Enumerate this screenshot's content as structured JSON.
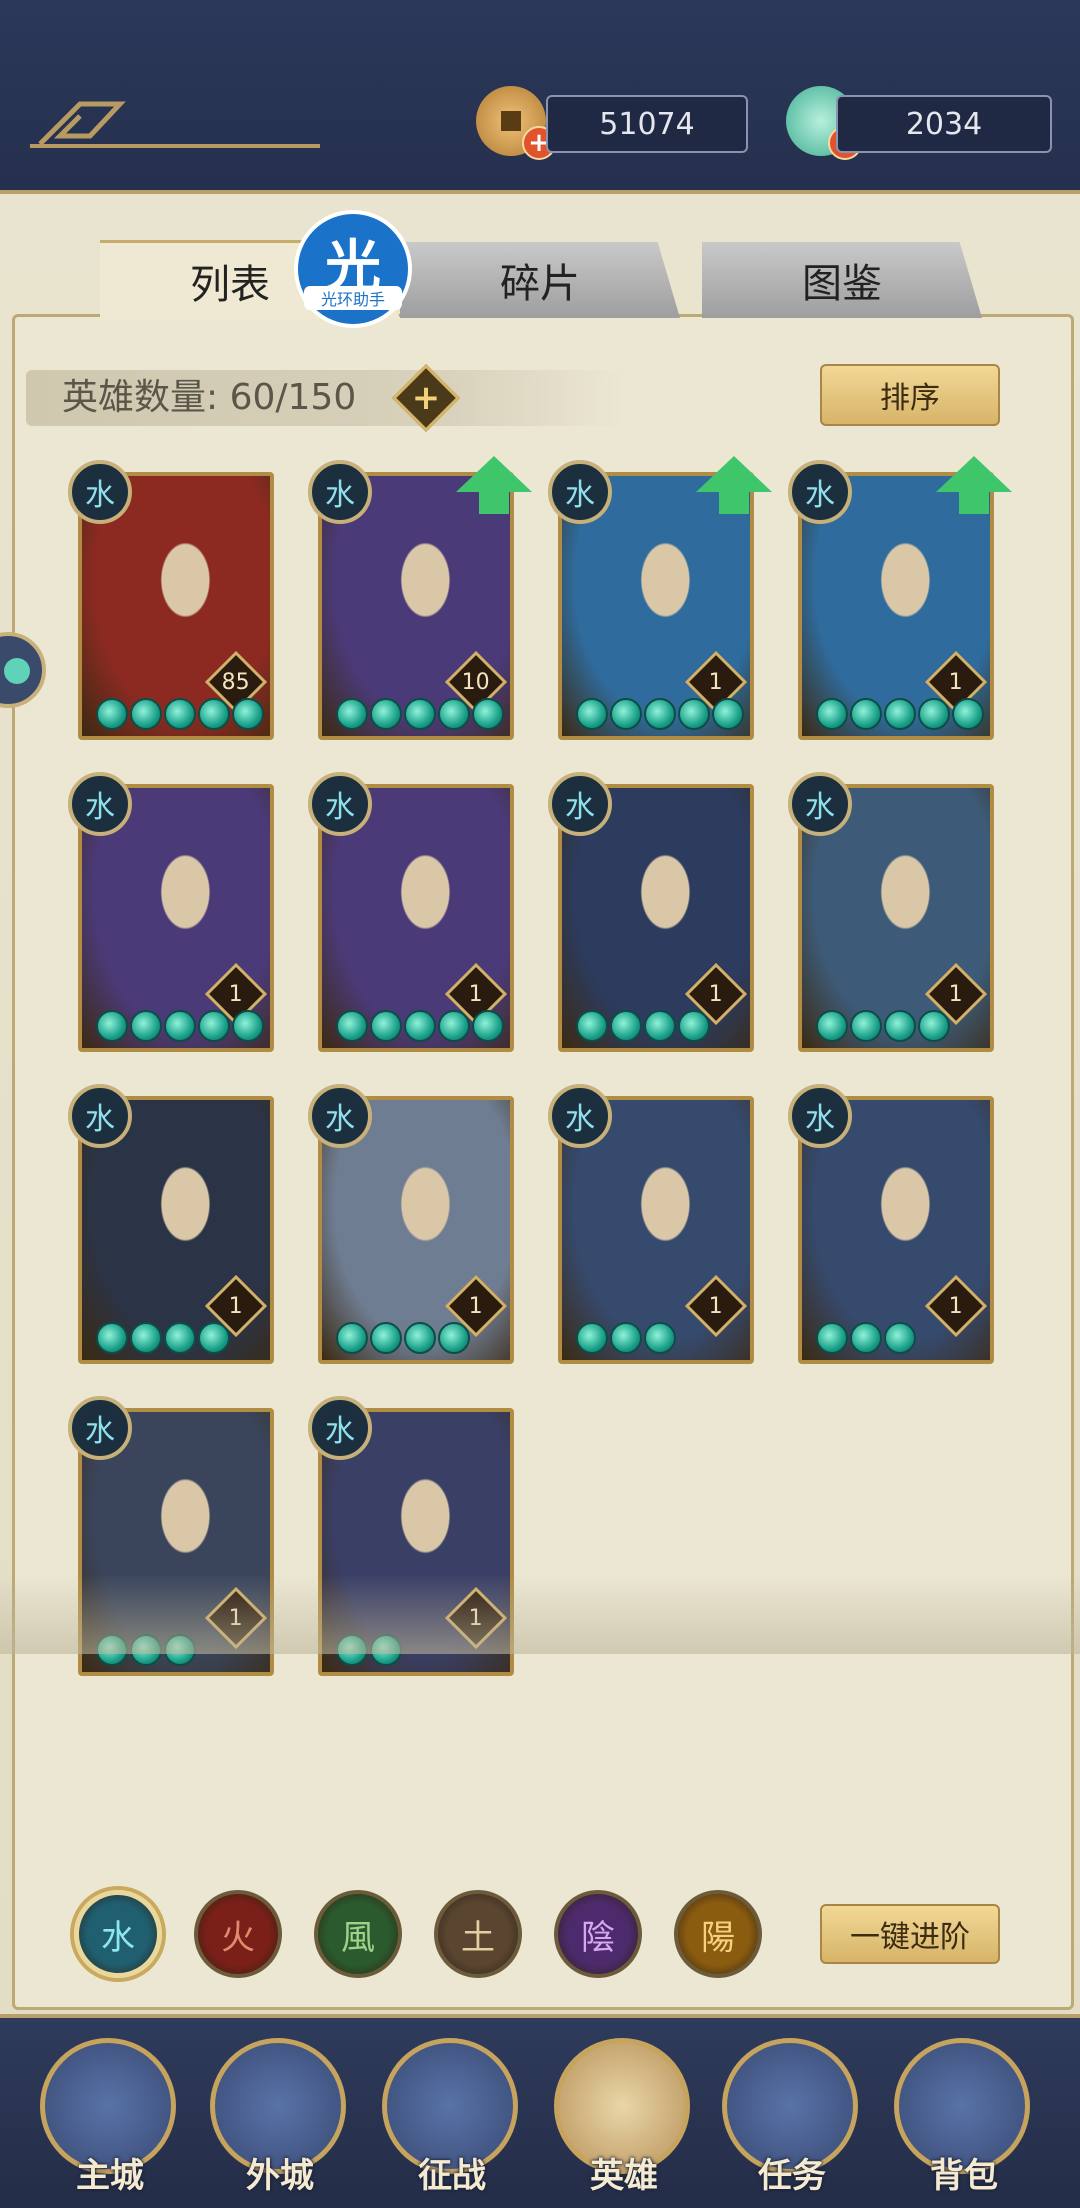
{
  "resources": {
    "coins": "51074",
    "gems": "2034"
  },
  "tabs": [
    {
      "label": "列表",
      "active": true
    },
    {
      "label": "碎片",
      "active": false
    },
    {
      "label": "图鉴",
      "active": false
    }
  ],
  "watermark": {
    "glyph": "光",
    "text": "光环助手"
  },
  "hero_count": {
    "label": "英雄数量:",
    "value": "60/150"
  },
  "sort_button": "排序",
  "heroes": [
    {
      "level": "85",
      "stars": 5,
      "upgradable": false,
      "art": "#8c2a22"
    },
    {
      "level": "10",
      "stars": 5,
      "upgradable": true,
      "art": "#4b3a78"
    },
    {
      "level": "1",
      "stars": 5,
      "upgradable": true,
      "art": "#2f6b9c"
    },
    {
      "level": "1",
      "stars": 5,
      "upgradable": true,
      "art": "#2f6b9c"
    },
    {
      "level": "1",
      "stars": 5,
      "upgradable": false,
      "art": "#4b3a78"
    },
    {
      "level": "1",
      "stars": 5,
      "upgradable": false,
      "art": "#4b3a78"
    },
    {
      "level": "1",
      "stars": 4,
      "upgradable": false,
      "art": "#2c3b5e"
    },
    {
      "level": "1",
      "stars": 4,
      "upgradable": false,
      "art": "#3d5b78"
    },
    {
      "level": "1",
      "stars": 4,
      "upgradable": false,
      "art": "#2b3447"
    },
    {
      "level": "1",
      "stars": 4,
      "upgradable": false,
      "art": "#6f7d92"
    },
    {
      "level": "1",
      "stars": 3,
      "upgradable": false,
      "art": "#364a6e"
    },
    {
      "level": "1",
      "stars": 3,
      "upgradable": false,
      "art": "#364a6e"
    },
    {
      "level": "1",
      "stars": 3,
      "upgradable": false,
      "art": "#3a455c"
    },
    {
      "level": "1",
      "stars": 2,
      "upgradable": false,
      "art": "#3a3f66"
    }
  ],
  "element_filters": [
    {
      "glyph": "水",
      "color": "#1f5f70",
      "fg": "#8fe6ef",
      "selected": true
    },
    {
      "glyph": "火",
      "color": "#7a2018",
      "fg": "#e08b6d",
      "selected": false
    },
    {
      "glyph": "風",
      "color": "#2b5a2e",
      "fg": "#9fd38a",
      "selected": false
    },
    {
      "glyph": "土",
      "color": "#5a4530",
      "fg": "#e6cf9f",
      "selected": false
    },
    {
      "glyph": "陰",
      "color": "#4d2a6b",
      "fg": "#d7a7ee",
      "selected": false
    },
    {
      "glyph": "陽",
      "color": "#8a5c10",
      "fg": "#f6d07a",
      "selected": false
    }
  ],
  "advance_button": "一键进阶",
  "nav": [
    {
      "label": "主城",
      "icon": "city-icon"
    },
    {
      "label": "外城",
      "icon": "gate-icon"
    },
    {
      "label": "征战",
      "icon": "battle-icon"
    },
    {
      "label": "英雄",
      "icon": "hero-icon",
      "active": true
    },
    {
      "label": "任务",
      "icon": "quest-icon"
    },
    {
      "label": "背包",
      "icon": "bag-icon"
    }
  ]
}
